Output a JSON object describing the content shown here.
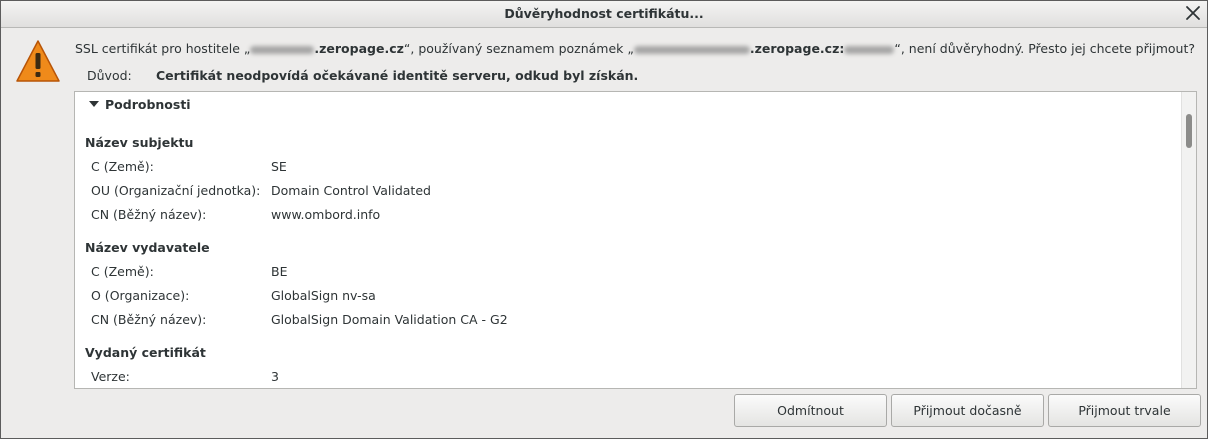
{
  "window": {
    "title": "Důvěryhodnost certifikátu..."
  },
  "message": {
    "part1": "SSL certifikát pro hostitele „",
    "host_suffix": ".zeropage.cz",
    "part2": "“, používaný seznamem poznámek „",
    "notes_suffix": ".zeropage.cz:",
    "part3": "“, není důvěryhodný. Přesto jej chcete přijmout?"
  },
  "reason": {
    "label": "Důvod:",
    "text": "Certifikát neodpovídá očekávané identitě serveru, odkud byl získán."
  },
  "details": {
    "expander_label": "Podrobnosti",
    "sections": [
      {
        "title": "Název subjektu",
        "fields": [
          {
            "label": "C (Země):",
            "value": "SE"
          },
          {
            "label": "OU (Organizační jednotka):",
            "value": "Domain Control Validated"
          },
          {
            "label": "CN (Běžný název):",
            "value": "www.ombord.info"
          }
        ]
      },
      {
        "title": "Název vydavatele",
        "fields": [
          {
            "label": "C (Země):",
            "value": "BE"
          },
          {
            "label": "O (Organizace):",
            "value": "GlobalSign nv-sa"
          },
          {
            "label": "CN (Běžný název):",
            "value": "GlobalSign Domain Validation CA - G2"
          }
        ]
      },
      {
        "title": "Vydaný certifikát",
        "fields": [
          {
            "label": "Verze:",
            "value": "3"
          }
        ]
      }
    ]
  },
  "buttons": {
    "reject": "Odmítnout",
    "accept_temp": "Přijmout dočasně",
    "accept_perm": "Přijmout trvale"
  },
  "icons": {
    "warning": "warning-icon",
    "close": "close-icon",
    "expander": "triangle-down-icon"
  },
  "colors": {
    "warning_fill": "#e8760b",
    "warning_border": "#c95e05"
  }
}
